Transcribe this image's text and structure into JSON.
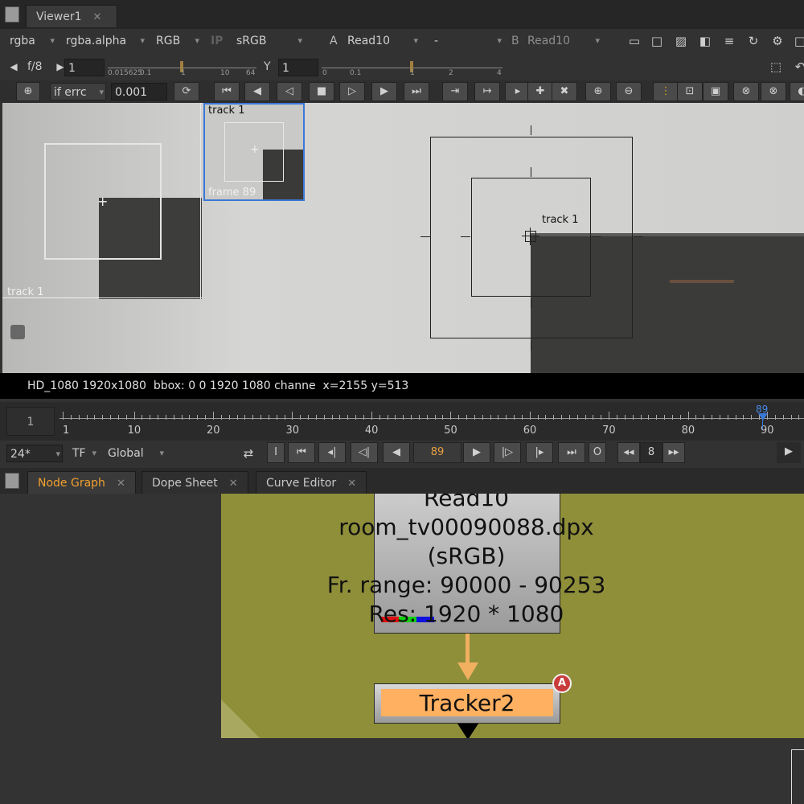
{
  "viewer_tab": {
    "label": "Viewer1",
    "close": "✕"
  },
  "toolbar1": {
    "channels": "rgba",
    "alpha": "rgba.alpha",
    "display": "RGB",
    "ip": "IP",
    "colorspace": "sRGB",
    "a_label": "A",
    "a_input": "Read10",
    "op": "-",
    "b_label": "B",
    "b_input": "Read10"
  },
  "toolbar2": {
    "fstop_label": "f/8",
    "gain_value": "1",
    "gain_ticks": [
      "0.015625",
      "0.1",
      "1",
      "10",
      "64"
    ],
    "gamma_label": "Y",
    "gamma_value": "1",
    "gamma_ticks": [
      "0",
      "0.1",
      "1",
      "2",
      "4"
    ]
  },
  "toolbar3": {
    "on_error": "if errc",
    "threshold": "0.001"
  },
  "viewer": {
    "zoom_track_label": "track 1",
    "zoom_frame_label": "frame 89",
    "left_track_label": "track 1",
    "main_track_label": "track 1"
  },
  "status_text": "HD_1080 1920x1080  bbox: 0 0 1920 1080 channe  x=2155 y=513",
  "timeline": {
    "start_frame": "1",
    "current_marker": "89",
    "labels": [
      "1",
      "10",
      "20",
      "30",
      "40",
      "50",
      "60",
      "70",
      "80",
      "90"
    ]
  },
  "playback": {
    "fps": "24*",
    "timecode": "TF",
    "range": "Global",
    "in_label": "I",
    "out_label": "O",
    "current_frame": "89",
    "skip": "8"
  },
  "panel_tabs": [
    {
      "label": "Node Graph",
      "close": "✕"
    },
    {
      "label": "Dope Sheet",
      "close": "✕"
    },
    {
      "label": "Curve Editor",
      "close": "✕"
    }
  ],
  "nodes": {
    "read": {
      "name": "Read10",
      "file": "room_tv00090088.dpx",
      "colorspace": "(sRGB)",
      "range": "Fr. range: 90000 - 90253",
      "res": "Res: 1920 * 1080"
    },
    "tracker": {
      "name": "Tracker2",
      "badge": "A"
    }
  },
  "colors": {
    "accent_orange": "#f0a030",
    "node_graph_bg": "#8f8f3a",
    "tracker_node": "#ffb060",
    "selection_blue": "#3a78d8",
    "badge_red": "#c83c3c"
  }
}
